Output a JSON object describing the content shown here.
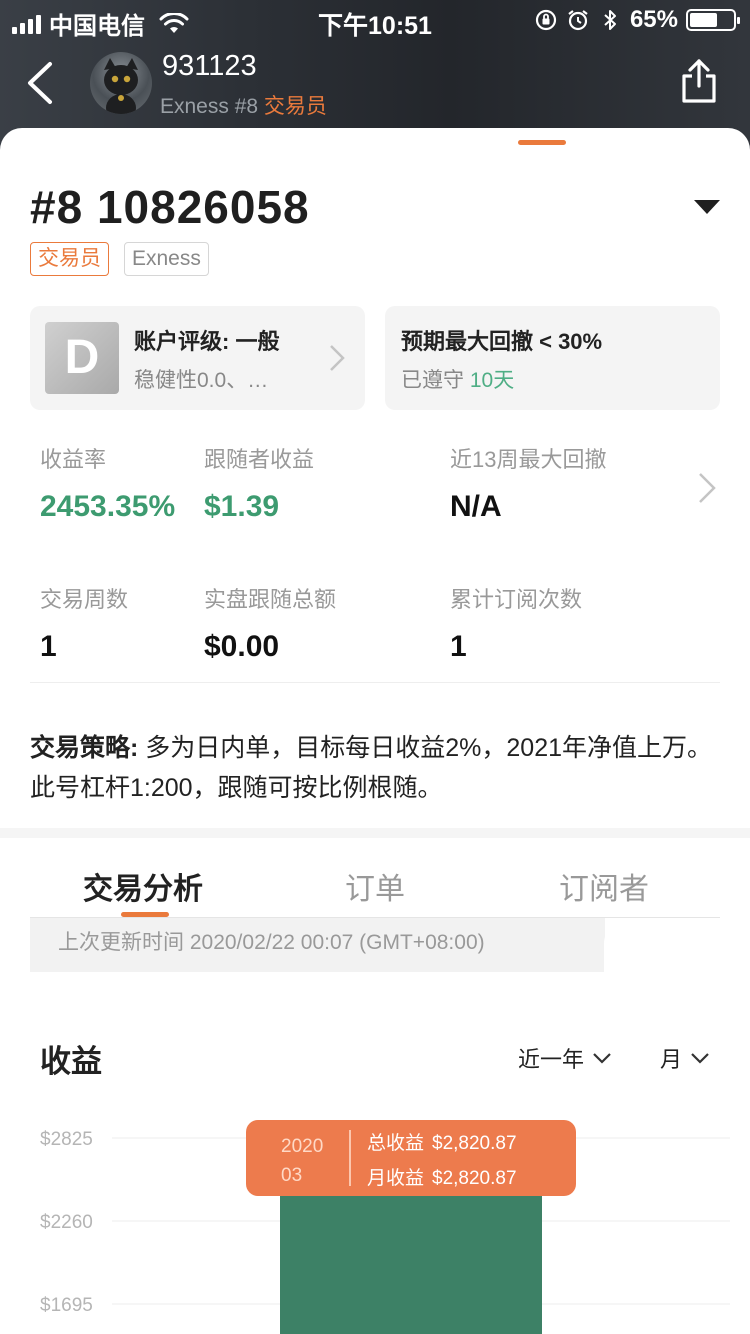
{
  "status_bar": {
    "carrier": "中国电信",
    "time": "下午10:51",
    "battery": "65%",
    "battery_level": 0.65
  },
  "header": {
    "username": "931123",
    "broker_prefix": "Exness #8 ",
    "role": "交易员",
    "icons": [
      "back-arrow-icon",
      "share-icon"
    ]
  },
  "account": {
    "title": "#8 10826058",
    "tags": [
      "交易员",
      "Exness"
    ]
  },
  "rating_box": {
    "grade": "D",
    "title": "账户评级: 一般",
    "subtitle": "稳健性0.0、…"
  },
  "drawdown_box": {
    "title": "预期最大回撤 < 30%",
    "subtitle": "已遵守 ",
    "days": "10天"
  },
  "metrics": [
    {
      "label": "收益率",
      "value": "2453.35%"
    },
    {
      "label": "跟随者收益",
      "value": "$1.39"
    },
    {
      "label": "近13周最大回撤",
      "value": "N/A"
    },
    {
      "label": "交易周数",
      "value": "1"
    },
    {
      "label": "实盘跟随总额",
      "value": "$0.00"
    },
    {
      "label": "累计订阅次数",
      "value": "1"
    }
  ],
  "strategy": {
    "label": "交易策略:",
    "text": " 多为日内单，目标每日收益2%，2021年净值上万。此号杠杆1:200，跟随可按比例根随。"
  },
  "tabs": [
    "交易分析",
    "订单",
    "订阅者"
  ],
  "update_text": "上次更新时间 2020/02/22 00:07 (GMT+08:00)",
  "profit": {
    "title": "收益",
    "range_filter": "近一年",
    "period_filter": "月"
  },
  "colors": {
    "accent": "#ea7a3c",
    "positive": "#3d9b70",
    "bar": "#3d8166",
    "tooltip": "#ed7b4d"
  },
  "chart_data": {
    "type": "bar",
    "categories": [
      "2020 03"
    ],
    "values": [
      2820.87
    ],
    "y_ticks": [
      "$2825",
      "$2260",
      "$1695"
    ],
    "y_tick_values": [
      2825,
      2260,
      1695
    ],
    "ylabel": "",
    "tooltip": {
      "date_line1": "2020",
      "date_line2": "03",
      "total_label": "总收益",
      "total_value": "$2,820.87",
      "month_label": "月收益",
      "month_value": "$2,820.87"
    }
  }
}
